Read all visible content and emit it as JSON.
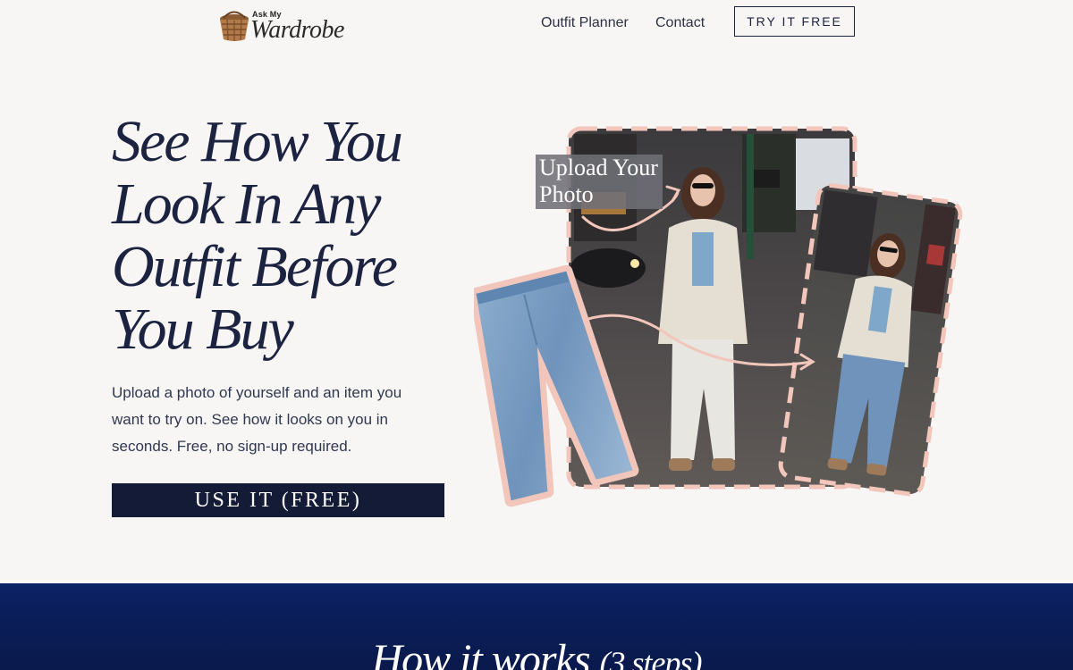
{
  "header": {
    "logo_small": "Ask My",
    "logo_big": "Wardrobe",
    "nav": [
      {
        "label": "Outfit Planner"
      },
      {
        "label": "Contact"
      }
    ],
    "cta": "TRY IT FREE"
  },
  "hero": {
    "title_lines": [
      "See How You",
      "Look In Any",
      "Outfit Before",
      "You Buy"
    ],
    "description": "Upload a photo of yourself and an item you want to try on. See how it looks on you in seconds. Free, no sign-up required.",
    "button": "USE IT (FREE)"
  },
  "illustration": {
    "label_lines": [
      "Upload Your",
      "Photo"
    ],
    "icons": [
      "jeans-image",
      "original-photo-image",
      "result-photo-image",
      "arrow-icon"
    ]
  },
  "how_it_works": {
    "title": "How it works",
    "steps": "(3 steps)"
  },
  "colors": {
    "background": "#f8f6f4",
    "navy": "#141b36",
    "accent_pink": "#f2c6ba",
    "section_blue": "#0c2266"
  }
}
